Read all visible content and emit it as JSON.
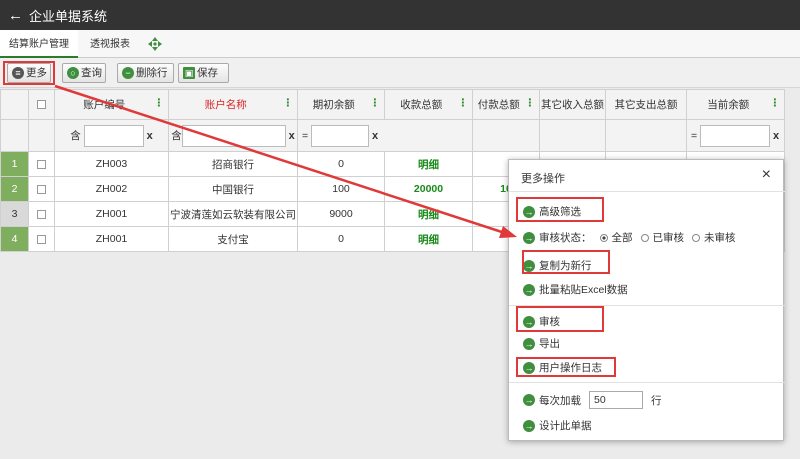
{
  "header": {
    "back_icon": "arrow-left-icon",
    "title": "企业单据系统"
  },
  "tabs": [
    {
      "label": "结算账户管理",
      "active": true
    },
    {
      "label": "透视报表",
      "active": false
    }
  ],
  "toolbar": {
    "more": "更多",
    "query": "查询",
    "delete_row": "删除行",
    "save": "保存"
  },
  "grid": {
    "columns": [
      "账户编号",
      "账户名称",
      "期初余额",
      "收款总额",
      "付款总额",
      "其它收入总额",
      "其它支出总额",
      "当前余额"
    ],
    "filter": {
      "contains": "含",
      "equals": "=",
      "clear": "x"
    },
    "rows": [
      {
        "num": "1",
        "code": "ZH003",
        "name": "招商银行",
        "init": "0",
        "recv": "明细",
        "pay": ""
      },
      {
        "num": "2",
        "code": "ZH002",
        "name": "中国银行",
        "init": "100",
        "recv": "20000",
        "pay": "10"
      },
      {
        "num": "3",
        "code": "ZH001",
        "name": "宁波清莲如云软装有限公司",
        "init": "9000",
        "recv": "明细",
        "pay": ""
      },
      {
        "num": "4",
        "code": "ZH001",
        "name": "支付宝",
        "init": "0",
        "recv": "明细",
        "pay": ""
      }
    ]
  },
  "modal": {
    "title": "更多操作",
    "close": "×",
    "items": {
      "advanced_filter": "高级筛选",
      "review_status": "审核状态：",
      "status_all": "全部",
      "status_reviewed": "已审核",
      "status_unreviewed": "未审核",
      "copy_new_row": "复制为新行",
      "batch_paste": "批量粘贴Excel数据",
      "review": "审核",
      "export": "导出",
      "user_log": "用户操作日志",
      "load_each": "每次加载",
      "load_value": "50",
      "load_unit": "行",
      "design": "设计此单据"
    }
  },
  "colors": {
    "accent_green": "#3f8f3f",
    "annotation_red": "#e0393a",
    "titlebar": "#333333"
  }
}
